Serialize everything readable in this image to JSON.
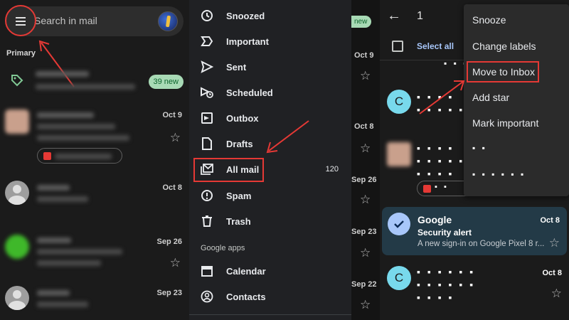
{
  "left_panel": {
    "search_placeholder": "Search in mail",
    "section_label": "Primary",
    "promotions_badge": "39 new",
    "dates": [
      "Oct 9",
      "Oct 8",
      "Sep 26",
      "Sep 23"
    ],
    "colors": {
      "badge_bg": "#a8dab5",
      "badge_text": "#0d652d",
      "annotation": "#e53935"
    }
  },
  "drawer": {
    "items": [
      {
        "label": "Snoozed",
        "icon": "clock-icon"
      },
      {
        "label": "Important",
        "icon": "important-icon"
      },
      {
        "label": "Sent",
        "icon": "send-icon"
      },
      {
        "label": "Scheduled",
        "icon": "scheduled-icon"
      },
      {
        "label": "Outbox",
        "icon": "outbox-icon"
      },
      {
        "label": "Drafts",
        "icon": "draft-icon"
      },
      {
        "label": "All mail",
        "icon": "all-mail-icon",
        "count": "120"
      },
      {
        "label": "Spam",
        "icon": "spam-icon"
      },
      {
        "label": "Trash",
        "icon": "trash-icon"
      }
    ],
    "section_header": "Google apps",
    "apps": [
      {
        "label": "Calendar",
        "icon": "calendar-icon"
      },
      {
        "label": "Contacts",
        "icon": "contacts-icon"
      }
    ]
  },
  "middle_strip": {
    "badge": "new",
    "dates": [
      "Oct 9",
      "Oct 8",
      "Sep 26",
      "Sep 23",
      "Sep 22"
    ]
  },
  "right_panel": {
    "selected_count": "1",
    "select_all_label": "Select all",
    "avatar_letter": "C",
    "menu_items": [
      "Snooze",
      "Change labels",
      "Move to Inbox",
      "Add star",
      "Mark important"
    ],
    "selected_email": {
      "sender": "Google",
      "subject": "Security alert",
      "preview": "A new sign-in on Google Pixel 8 r...",
      "date": "Oct 8"
    },
    "last_row_date": "Oct 8",
    "colors": {
      "selected_bg": "#233a47",
      "check_circle": "#a8c7fa",
      "avatar_bg": "#78d9ec"
    }
  }
}
